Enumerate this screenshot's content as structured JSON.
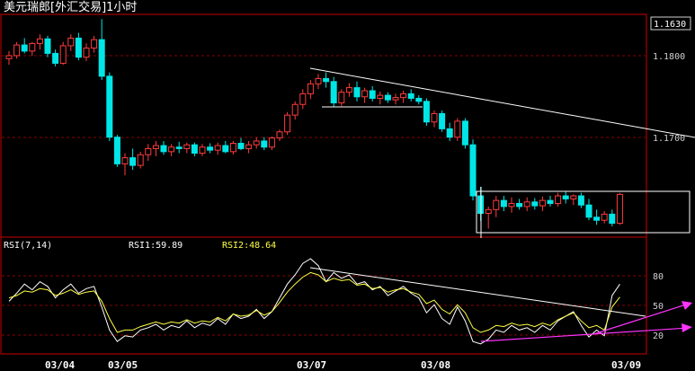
{
  "title": "美元瑞郎[外汇交易]1小时",
  "colors": {
    "up": "#ff3c3c",
    "down": "#00e6e6",
    "frame": "#c80000",
    "grid": "#8a0000",
    "axis_text": "#d0d0d0",
    "rsi1": "#ffffff",
    "rsi2": "#ffff44",
    "trend": "#ffffff",
    "arrow": "#ff33ff"
  },
  "price_axis": {
    "labels": [
      "1.1800",
      "1.1700"
    ],
    "current": "1.1630"
  },
  "rsi": {
    "label": "RSI(7,14)",
    "rsi1_label": "RSI1:59.89",
    "rsi2_label": "RSI2:48.64",
    "levels": [
      "80",
      "50",
      "20"
    ]
  },
  "dates": [
    "03/04",
    "03/05",
    "03/07",
    "03/08",
    "03/09"
  ],
  "chart_data": {
    "type": "candlestick",
    "title": "美元瑞郎[外汇交易]1小时",
    "ylim": [
      1.1575,
      1.1865
    ],
    "candles": [
      [
        1.1808,
        1.1818,
        1.18,
        1.1812
      ],
      [
        1.1812,
        1.183,
        1.1808,
        1.1826
      ],
      [
        1.1826,
        1.1835,
        1.1815,
        1.1818
      ],
      [
        1.1818,
        1.183,
        1.1812,
        1.1828
      ],
      [
        1.1828,
        1.184,
        1.182,
        1.1834
      ],
      [
        1.1834,
        1.1838,
        1.181,
        1.1815
      ],
      [
        1.1815,
        1.182,
        1.1798,
        1.1802
      ],
      [
        1.1802,
        1.183,
        1.18,
        1.1825
      ],
      [
        1.1825,
        1.184,
        1.1818,
        1.1835
      ],
      [
        1.1835,
        1.1842,
        1.1806,
        1.181
      ],
      [
        1.181,
        1.1828,
        1.1805,
        1.1822
      ],
      [
        1.1822,
        1.1838,
        1.1816,
        1.1833
      ],
      [
        1.1833,
        1.186,
        1.178,
        1.1785
      ],
      [
        1.1785,
        1.179,
        1.17,
        1.1705
      ],
      [
        1.1705,
        1.1708,
        1.1666,
        1.167
      ],
      [
        1.167,
        1.1684,
        1.1655,
        1.1678
      ],
      [
        1.1678,
        1.169,
        1.1662,
        1.1668
      ],
      [
        1.1668,
        1.1686,
        1.1664,
        1.1682
      ],
      [
        1.1682,
        1.1696,
        1.1674,
        1.169
      ],
      [
        1.169,
        1.17,
        1.168,
        1.1694
      ],
      [
        1.1694,
        1.17,
        1.1682,
        1.1686
      ],
      [
        1.1686,
        1.1696,
        1.168,
        1.1692
      ],
      [
        1.1692,
        1.1699,
        1.1684,
        1.169
      ],
      [
        1.169,
        1.1698,
        1.1684,
        1.1695
      ],
      [
        1.1695,
        1.1698,
        1.168,
        1.1684
      ],
      [
        1.1684,
        1.1696,
        1.168,
        1.1692
      ],
      [
        1.1692,
        1.1697,
        1.1684,
        1.1688
      ],
      [
        1.1688,
        1.1698,
        1.1682,
        1.1694
      ],
      [
        1.1694,
        1.17,
        1.1684,
        1.1686
      ],
      [
        1.1686,
        1.17,
        1.1682,
        1.1697
      ],
      [
        1.1697,
        1.1704,
        1.1688,
        1.169
      ],
      [
        1.169,
        1.17,
        1.1684,
        1.1695
      ],
      [
        1.1695,
        1.1705,
        1.169,
        1.17
      ],
      [
        1.17,
        1.1705,
        1.1688,
        1.1692
      ],
      [
        1.1692,
        1.1706,
        1.1688,
        1.1704
      ],
      [
        1.1704,
        1.1715,
        1.17,
        1.1712
      ],
      [
        1.1712,
        1.1738,
        1.1708,
        1.1734
      ],
      [
        1.1734,
        1.1752,
        1.1728,
        1.1748
      ],
      [
        1.1748,
        1.1768,
        1.1742,
        1.1762
      ],
      [
        1.1762,
        1.178,
        1.1755,
        1.1775
      ],
      [
        1.1775,
        1.1788,
        1.1768,
        1.1782
      ],
      [
        1.1782,
        1.179,
        1.177,
        1.1778
      ],
      [
        1.1778,
        1.1784,
        1.1745,
        1.175
      ],
      [
        1.175,
        1.1768,
        1.1746,
        1.1764
      ],
      [
        1.1764,
        1.1776,
        1.1758,
        1.177
      ],
      [
        1.177,
        1.1778,
        1.1752,
        1.1758
      ],
      [
        1.1758,
        1.177,
        1.175,
        1.1766
      ],
      [
        1.1766,
        1.1772,
        1.1752,
        1.1756
      ],
      [
        1.1756,
        1.1765,
        1.1748,
        1.176
      ],
      [
        1.176,
        1.1764,
        1.175,
        1.1754
      ],
      [
        1.1754,
        1.1762,
        1.1748,
        1.1757
      ],
      [
        1.1757,
        1.1766,
        1.175,
        1.1762
      ],
      [
        1.1762,
        1.1768,
        1.1752,
        1.1756
      ],
      [
        1.1756,
        1.176,
        1.1748,
        1.1752
      ],
      [
        1.1752,
        1.1756,
        1.172,
        1.1725
      ],
      [
        1.1725,
        1.174,
        1.1718,
        1.1736
      ],
      [
        1.1736,
        1.174,
        1.1712,
        1.1716
      ],
      [
        1.1716,
        1.1724,
        1.17,
        1.1705
      ],
      [
        1.1705,
        1.173,
        1.17,
        1.1726
      ],
      [
        1.1726,
        1.173,
        1.169,
        1.1695
      ],
      [
        1.1695,
        1.1702,
        1.1622,
        1.1628
      ],
      [
        1.1628,
        1.164,
        1.1595,
        1.1605
      ],
      [
        1.1605,
        1.1614,
        1.1585,
        1.161
      ],
      [
        1.161,
        1.1628,
        1.16,
        1.1622
      ],
      [
        1.1622,
        1.1628,
        1.1608,
        1.1614
      ],
      [
        1.1614,
        1.1626,
        1.1606,
        1.1618
      ],
      [
        1.1618,
        1.1624,
        1.161,
        1.1614
      ],
      [
        1.1614,
        1.1626,
        1.1608,
        1.162
      ],
      [
        1.162,
        1.1625,
        1.161,
        1.1615
      ],
      [
        1.1615,
        1.1627,
        1.1608,
        1.1622
      ],
      [
        1.1622,
        1.1628,
        1.1614,
        1.1618
      ],
      [
        1.1618,
        1.1632,
        1.1614,
        1.1628
      ],
      [
        1.1628,
        1.1634,
        1.1618,
        1.1624
      ],
      [
        1.1624,
        1.163,
        1.1616,
        1.1628
      ],
      [
        1.1628,
        1.1632,
        1.1612,
        1.1616
      ],
      [
        1.1616,
        1.1624,
        1.1596,
        1.16
      ],
      [
        1.16,
        1.161,
        1.159,
        1.1596
      ],
      [
        1.1596,
        1.1608,
        1.1592,
        1.1604
      ],
      [
        1.1604,
        1.161,
        1.1588,
        1.1592
      ],
      [
        1.1592,
        1.1632,
        1.159,
        1.163
      ]
    ],
    "rsi1": [
      45,
      52,
      60,
      55,
      62,
      58,
      48,
      55,
      60,
      52,
      56,
      58,
      40,
      20,
      10,
      15,
      14,
      20,
      22,
      25,
      20,
      24,
      22,
      28,
      22,
      26,
      24,
      30,
      25,
      34,
      30,
      32,
      38,
      30,
      36,
      48,
      60,
      68,
      78,
      82,
      76,
      62,
      70,
      65,
      68,
      60,
      62,
      55,
      58,
      50,
      54,
      58,
      52,
      48,
      35,
      42,
      30,
      25,
      40,
      28,
      10,
      8,
      12,
      20,
      18,
      24,
      20,
      22,
      18,
      24,
      20,
      28,
      32,
      36,
      24,
      14,
      20,
      15,
      50,
      59.89
    ],
    "rsi2": [
      48,
      50,
      54,
      53,
      56,
      55,
      50,
      52,
      55,
      51,
      53,
      54,
      45,
      30,
      18,
      20,
      20,
      23,
      25,
      27,
      25,
      27,
      26,
      29,
      26,
      28,
      27,
      31,
      28,
      34,
      32,
      33,
      37,
      33,
      36,
      44,
      53,
      60,
      66,
      70,
      68,
      62,
      65,
      63,
      64,
      59,
      60,
      56,
      57,
      53,
      55,
      56,
      53,
      51,
      43,
      46,
      38,
      34,
      42,
      35,
      22,
      18,
      20,
      24,
      23,
      26,
      24,
      25,
      23,
      26,
      24,
      29,
      32,
      35,
      28,
      22,
      24,
      20,
      40,
      48.64
    ],
    "overlays": [
      "downtrend line",
      "consolidation boxes",
      "rsi trend lines with arrows"
    ]
  }
}
